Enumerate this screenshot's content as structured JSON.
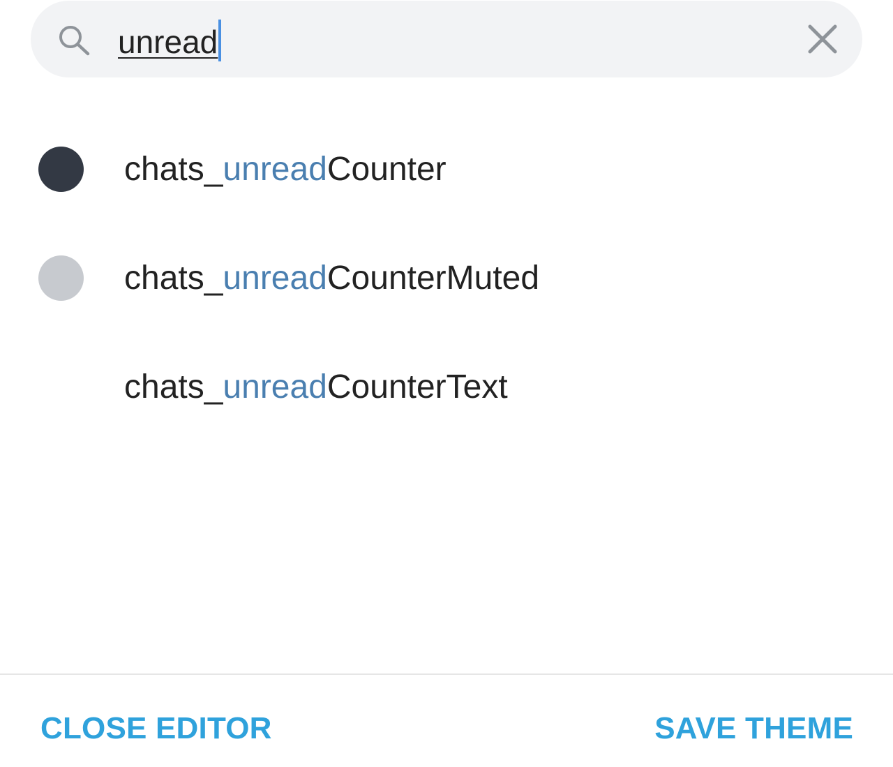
{
  "search": {
    "query": "unread"
  },
  "results": [
    {
      "prefix": "chats_",
      "match": "unread",
      "suffix": "Counter",
      "swatch_color": "#333944"
    },
    {
      "prefix": "chats_",
      "match": "unread",
      "suffix": "CounterMuted",
      "swatch_color": "#c7cacf"
    },
    {
      "prefix": "chats_",
      "match": "unread",
      "suffix": "CounterText",
      "swatch_color": "#ffffff"
    }
  ],
  "footer": {
    "close_label": "CLOSE EDITOR",
    "save_label": "SAVE THEME"
  },
  "colors": {
    "accent": "#2fa2dc",
    "match_highlight": "#4a7fb0",
    "search_bg": "#f2f3f5"
  },
  "icons": {
    "search": "search-icon",
    "clear": "close-icon"
  }
}
